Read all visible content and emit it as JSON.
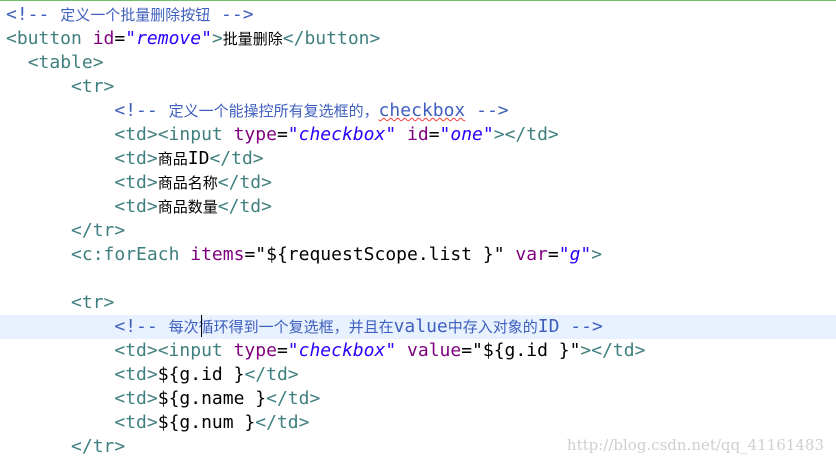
{
  "lines": [
    {
      "indent": "",
      "tokens": [
        {
          "t": "<!-- ",
          "c": "cmt"
        },
        {
          "t": "定义一个批量删除按钮",
          "c": "cmt cmt-cn"
        },
        {
          "t": " -->",
          "c": "cmt"
        }
      ]
    },
    {
      "indent": "",
      "tokens": [
        {
          "t": "<button",
          "c": "tag"
        },
        {
          "t": " ",
          "c": "txt"
        },
        {
          "t": "id",
          "c": "attr"
        },
        {
          "t": "=",
          "c": "txt"
        },
        {
          "t": "\"remove\"",
          "c": "val"
        },
        {
          "t": ">",
          "c": "tag"
        },
        {
          "t": "批量删除",
          "c": "txt cn"
        },
        {
          "t": "</button>",
          "c": "tag"
        }
      ]
    },
    {
      "indent": "  ",
      "tokens": [
        {
          "t": "<table>",
          "c": "tag"
        }
      ]
    },
    {
      "indent": "      ",
      "tokens": [
        {
          "t": "<tr>",
          "c": "tag"
        }
      ]
    },
    {
      "indent": "          ",
      "tokens": [
        {
          "t": "<!-- ",
          "c": "cmt"
        },
        {
          "t": "定义一个能操控所有复选框的，",
          "c": "cmt cmt-cn"
        },
        {
          "t": "checkbox",
          "c": "cmt spell"
        },
        {
          "t": " -->",
          "c": "cmt"
        }
      ]
    },
    {
      "indent": "          ",
      "tokens": [
        {
          "t": "<td><input",
          "c": "tag"
        },
        {
          "t": " ",
          "c": "txt"
        },
        {
          "t": "type",
          "c": "attr"
        },
        {
          "t": "=",
          "c": "txt"
        },
        {
          "t": "\"checkbox\"",
          "c": "val"
        },
        {
          "t": " ",
          "c": "txt"
        },
        {
          "t": "id",
          "c": "attr"
        },
        {
          "t": "=",
          "c": "txt"
        },
        {
          "t": "\"one\"",
          "c": "val"
        },
        {
          "t": "></td>",
          "c": "tag"
        }
      ]
    },
    {
      "indent": "          ",
      "tokens": [
        {
          "t": "<td>",
          "c": "tag"
        },
        {
          "t": "商品",
          "c": "txt cn"
        },
        {
          "t": "ID",
          "c": "txt"
        },
        {
          "t": "</td>",
          "c": "tag"
        }
      ]
    },
    {
      "indent": "          ",
      "tokens": [
        {
          "t": "<td>",
          "c": "tag"
        },
        {
          "t": "商品名称",
          "c": "txt cn"
        },
        {
          "t": "</td>",
          "c": "tag"
        }
      ]
    },
    {
      "indent": "          ",
      "tokens": [
        {
          "t": "<td>",
          "c": "tag"
        },
        {
          "t": "商品数量",
          "c": "txt cn"
        },
        {
          "t": "</td>",
          "c": "tag"
        }
      ]
    },
    {
      "indent": "      ",
      "tokens": [
        {
          "t": "</tr>",
          "c": "tag"
        }
      ]
    },
    {
      "indent": "      ",
      "tokens": [
        {
          "t": "<c:forEach",
          "c": "tag"
        },
        {
          "t": " ",
          "c": "txt"
        },
        {
          "t": "items",
          "c": "attr"
        },
        {
          "t": "=",
          "c": "txt"
        },
        {
          "t": "\"${requestScope.list }\"",
          "c": "txt"
        },
        {
          "t": " ",
          "c": "txt"
        },
        {
          "t": "var",
          "c": "attr"
        },
        {
          "t": "=",
          "c": "txt"
        },
        {
          "t": "\"g\"",
          "c": "val"
        },
        {
          "t": ">",
          "c": "tag"
        }
      ]
    },
    {
      "indent": "",
      "tokens": []
    },
    {
      "indent": "      ",
      "tokens": [
        {
          "t": "<tr>",
          "c": "tag"
        }
      ]
    },
    {
      "indent": "          ",
      "current": true,
      "tokens": [
        {
          "t": "<!-- ",
          "c": "cmt"
        },
        {
          "t": "每次循环得到一个复选框，并且在",
          "c": "cmt cmt-cn"
        },
        {
          "t": "value",
          "c": "cmt"
        },
        {
          "t": "中存入对象的",
          "c": "cmt cmt-cn"
        },
        {
          "t": "ID -->",
          "c": "cmt"
        }
      ]
    },
    {
      "indent": "          ",
      "tokens": [
        {
          "t": "<td><input",
          "c": "tag"
        },
        {
          "t": " ",
          "c": "txt"
        },
        {
          "t": "type",
          "c": "attr"
        },
        {
          "t": "=",
          "c": "txt"
        },
        {
          "t": "\"checkbox\"",
          "c": "val"
        },
        {
          "t": " ",
          "c": "txt"
        },
        {
          "t": "value",
          "c": "attr"
        },
        {
          "t": "=",
          "c": "txt"
        },
        {
          "t": "\"${g.id }\"",
          "c": "txt"
        },
        {
          "t": "></td>",
          "c": "tag"
        }
      ]
    },
    {
      "indent": "          ",
      "tokens": [
        {
          "t": "<td>",
          "c": "tag"
        },
        {
          "t": "${g.id }",
          "c": "txt"
        },
        {
          "t": "</td>",
          "c": "tag"
        }
      ]
    },
    {
      "indent": "          ",
      "tokens": [
        {
          "t": "<td>",
          "c": "tag"
        },
        {
          "t": "${g.name }",
          "c": "txt"
        },
        {
          "t": "</td>",
          "c": "tag"
        }
      ]
    },
    {
      "indent": "          ",
      "tokens": [
        {
          "t": "<td>",
          "c": "tag"
        },
        {
          "t": "${g.num }",
          "c": "txt"
        },
        {
          "t": "</td>",
          "c": "tag"
        }
      ]
    },
    {
      "indent": "      ",
      "tokens": [
        {
          "t": "</tr>",
          "c": "tag"
        }
      ]
    }
  ],
  "watermark": "http://blog.csdn.net/qq_41161483"
}
